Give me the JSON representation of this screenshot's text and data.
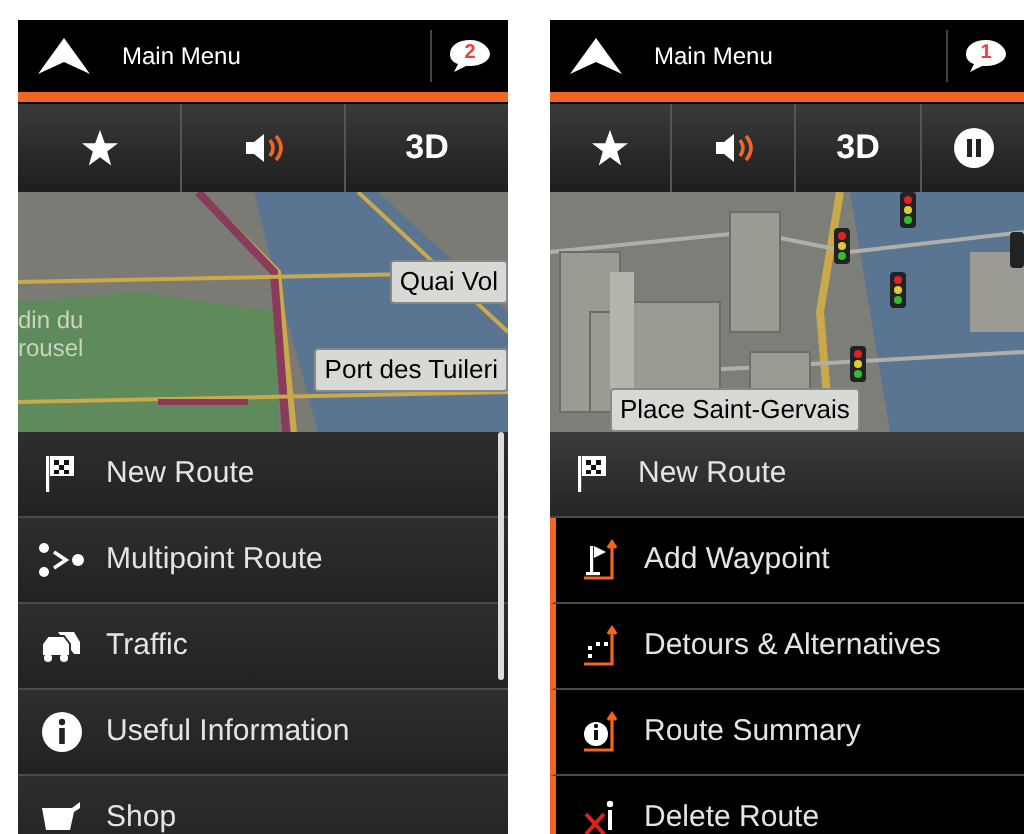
{
  "screens": [
    {
      "header": {
        "title": "Main Menu",
        "badge": "2"
      },
      "toolbar": [
        {
          "kind": "star"
        },
        {
          "kind": "sound"
        },
        {
          "kind": "text",
          "label": "3D"
        }
      ],
      "map": {
        "kind": "flat",
        "labels": [
          {
            "text": "Quai Vol",
            "kind": "callout"
          },
          {
            "text": "Port des Tuileri",
            "kind": "callout"
          },
          {
            "text": "din du",
            "kind": "plain"
          },
          {
            "text": "rousel",
            "kind": "plain"
          }
        ]
      },
      "menu": [
        {
          "label": "New Route",
          "kind": "main"
        },
        {
          "label": "Multipoint Route",
          "kind": "main"
        },
        {
          "label": "Traffic",
          "kind": "main"
        },
        {
          "label": "Useful Information",
          "kind": "main"
        },
        {
          "label": "Shop",
          "kind": "main"
        }
      ]
    },
    {
      "header": {
        "title": "Main Menu",
        "badge": "1"
      },
      "toolbar": [
        {
          "kind": "star"
        },
        {
          "kind": "sound"
        },
        {
          "kind": "text",
          "label": "3D"
        },
        {
          "kind": "pause"
        }
      ],
      "map": {
        "kind": "city3d",
        "labels": [
          {
            "text": "Place Saint-Gervais",
            "kind": "callout"
          }
        ]
      },
      "menu": [
        {
          "label": "New Route",
          "kind": "header"
        },
        {
          "label": "Add Waypoint",
          "kind": "sub"
        },
        {
          "label": "Detours & Alternatives",
          "kind": "sub"
        },
        {
          "label": "Route Summary",
          "kind": "sub"
        },
        {
          "label": "Delete Route",
          "kind": "sub"
        }
      ]
    }
  ]
}
